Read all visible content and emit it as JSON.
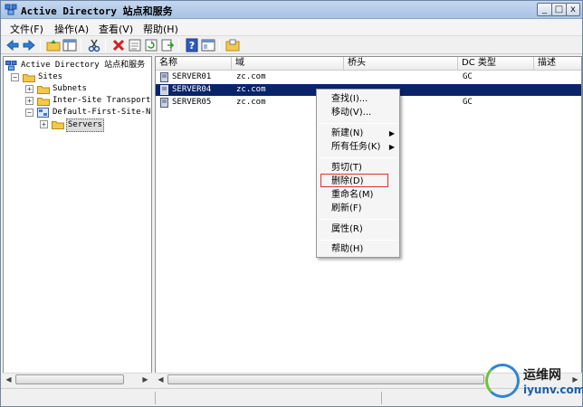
{
  "window": {
    "title": "Active Directory 站点和服务",
    "min_glyph": "_",
    "max_glyph": "□",
    "close_glyph": "x"
  },
  "menu": {
    "items": [
      "文件(F)",
      "操作(A)",
      "查看(V)",
      "帮助(H)"
    ]
  },
  "toolbar": {
    "icons": [
      "back-arrow-icon",
      "forward-arrow-icon",
      "up-folder-icon",
      "show-hide-tree-icon",
      "cut-icon",
      "delete-icon",
      "properties-icon",
      "refresh-icon",
      "export-list-icon",
      "help-icon",
      "console-icon",
      "new-icon"
    ]
  },
  "tree": {
    "root": "Active Directory 站点和服务",
    "sites": "Sites",
    "subnets": "Subnets",
    "transports": "Inter-Site Transports",
    "default_site": "Default-First-Site-Nam",
    "servers": "Servers",
    "collapse": "−",
    "expand": "+"
  },
  "list": {
    "columns": [
      "名称",
      "域",
      "桥头",
      "DC 类型",
      "描述"
    ],
    "rows": [
      {
        "name": "SERVER01",
        "domain": "zc.com",
        "bridgehead": "",
        "dc_type": "GC",
        "desc": ""
      },
      {
        "name": "SERVER04",
        "domain": "zc.com",
        "bridgehead": "",
        "dc_type": "",
        "desc": ""
      },
      {
        "name": "SERVER05",
        "domain": "zc.com",
        "bridgehead": "",
        "dc_type": "GC",
        "desc": ""
      }
    ],
    "selected_index": 1
  },
  "context_menu": {
    "find": "查找(I)...",
    "move": "移动(V)...",
    "new": "新建(N)",
    "all_tasks": "所有任务(K)",
    "cut": "剪切(T)",
    "delete": "删除(D)",
    "rename": "重命名(M)",
    "refresh": "刷新(F)",
    "properties": "属性(R)",
    "help": "帮助(H)",
    "submenu_arrow": "▶"
  },
  "scroll": {
    "left": "◀",
    "right": "▶"
  },
  "watermark": {
    "cn": "运维网",
    "url": "iyunv.com"
  },
  "colors": {
    "selection": "#0a246a",
    "highlight_box": "#e03030",
    "folder": "#f2c94c"
  }
}
